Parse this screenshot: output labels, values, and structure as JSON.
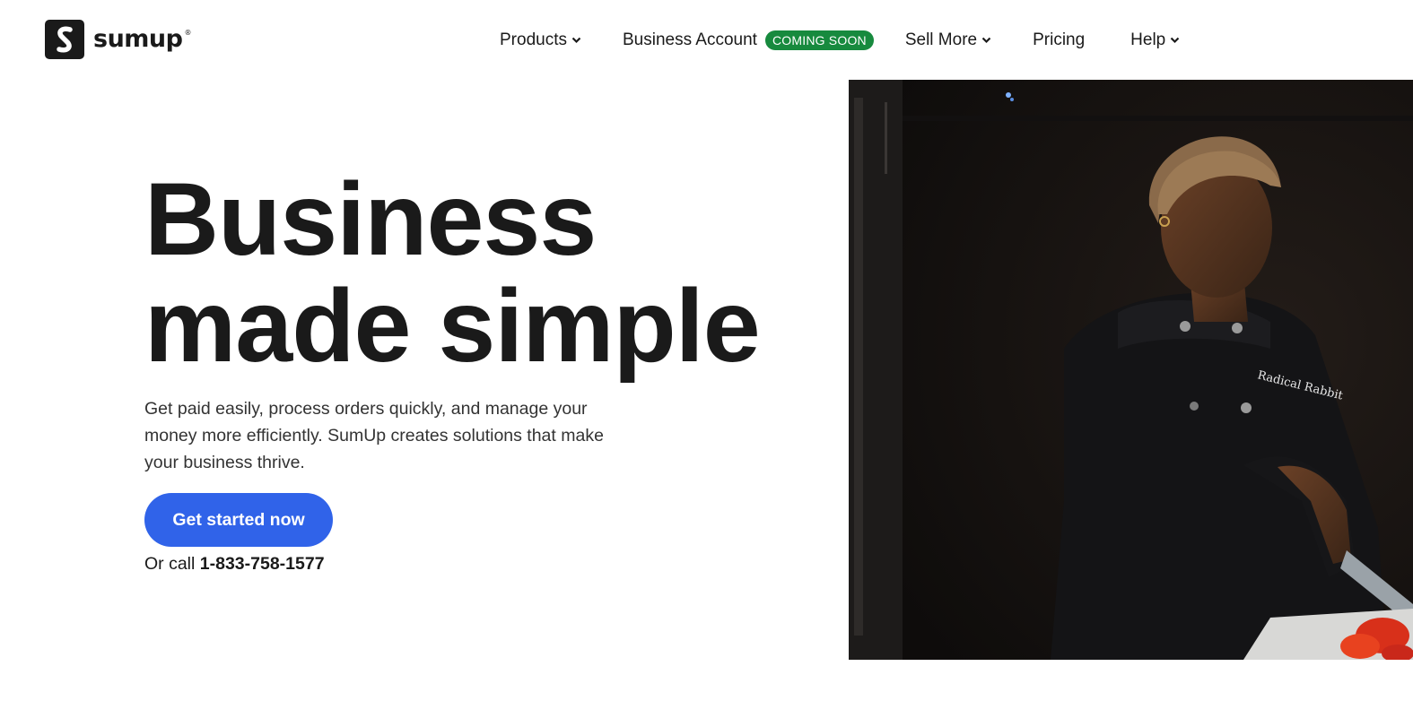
{
  "brand": {
    "name": "sumup",
    "reg": "®"
  },
  "nav": {
    "products": "Products",
    "business_account": "Business Account",
    "badge": "COMING SOON",
    "sell_more": "Sell More",
    "pricing": "Pricing",
    "help": "Help"
  },
  "hero": {
    "title_line1": "Business",
    "title_line2": "made simple",
    "subtitle": "Get paid easily, process orders quickly, and manage your money more efficiently. SumUp creates solutions that make your business thrive.",
    "cta": "Get started now",
    "call_prefix": "Or call",
    "phone": "1-833-758-1577",
    "image_text": "Radical Rabbit"
  },
  "colors": {
    "primary_button": "#3063e9",
    "badge": "#178a3e",
    "text": "#1a1a1a"
  }
}
